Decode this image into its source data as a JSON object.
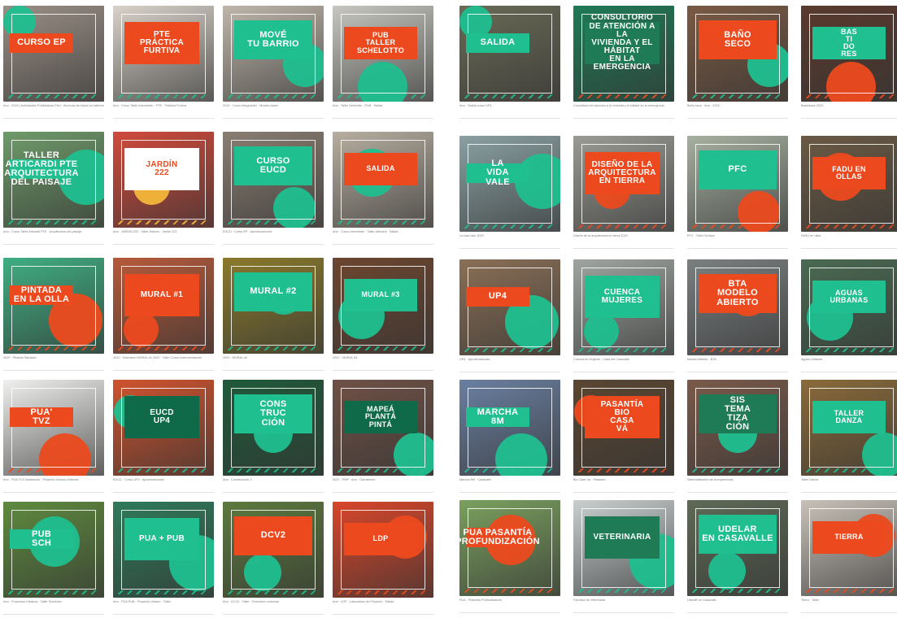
{
  "colors": {
    "orange": "#ec4a1e",
    "green": "#1fbf8f",
    "dark_green": "#0f6a4a",
    "white": "#ffffff"
  },
  "grid_left": [
    {
      "title": "CURSO EP",
      "caption": "Ano · 2018 | Actividades Publicitarias FAU · Alumnos de todos los talleres",
      "scene": "#9a8f86",
      "blob": "#1fbf8f",
      "box": "#ec4a1e",
      "ink": "#ffffff"
    },
    {
      "title": "PTE\nPRÁCTICA\nFURTIVA",
      "caption": "Ano · Curso Taller Intermedio · PTE · Práctica Furtiva",
      "scene": "#d8d2c9",
      "blob": "#1fbf8f",
      "box": "#ec4a1e",
      "ink": "#ffffff"
    },
    {
      "title": "MOVÉ\nTU BARRIO",
      "caption": "2019 · Curso Integración · Movetu barrio",
      "scene": "#bfb6aa",
      "blob": "#1fbf8f",
      "box": "#1fbf8f",
      "ink": "#ffffff"
    },
    {
      "title": "PUB\nTALLER\nSCHELOTTO",
      "caption": "Ano · Taller Schelotto · PUB · Salida",
      "scene": "#c7c7c0",
      "blob": "#1fbf8f",
      "box": "#ec4a1e",
      "ink": "#ffffff"
    },
    {
      "title": "TALLER\nARTICARDI PTE\nARQUITECTURA\nDEL PAISAJE",
      "caption": "Ano · Curso Taller Articardi PTE · Arquitectura del paisaje",
      "scene": "#6f9a6a",
      "blob": "#1fbf8f",
      "box": "#1fbf8f",
      "ink": "#ffffff"
    },
    {
      "title": "JARDÍN\n222",
      "caption": "Ano · JARDIN 222 · Taller Marcos · Jardín 222",
      "scene": "#d04a3c",
      "blob": "#f4b63a",
      "box": "#ffffff",
      "ink": "#ec4a1e"
    },
    {
      "title": "CURSO\nEUCD",
      "caption": "EUCD · Curso EP · Aproximaciones",
      "scene": "#8a7e72",
      "blob": "#1fbf8f",
      "box": "#1fbf8f",
      "ink": "#ffffff"
    },
    {
      "title": "SALIDA",
      "caption": "Ano · Curso Intermedio · Taller Articardi · Salida",
      "scene": "#b7aea0",
      "blob": "#1fbf8f",
      "box": "#ec4a1e",
      "ink": "#ffffff"
    },
    {
      "title": "PINTADA\nen la OLLA",
      "caption": "2020 · Pintada Salvador",
      "scene": "#3fae82",
      "blob": "#ec4a1e",
      "box": "#ec4a1e",
      "ink": "#ffffff"
    },
    {
      "title": "MURAL #1",
      "caption": "2020 · Extensión MURAL #1 2020 · Taller Curso Instrumentación",
      "scene": "#b65a3b",
      "blob": "#ec4a1e",
      "box": "#ec4a1e",
      "ink": "#ffffff"
    },
    {
      "title": "MURAL #2",
      "caption": "2020 · MURAL #2",
      "scene": "#8a7a2c",
      "blob": "#1fbf8f",
      "box": "#1fbf8f",
      "ink": "#ffffff"
    },
    {
      "title": "MURAL #3",
      "caption": "2020 · MURAL #3",
      "scene": "#6c4630",
      "blob": "#1fbf8f",
      "box": "#1fbf8f",
      "ink": "#ffffff"
    },
    {
      "title": "PUA'\nTVZ",
      "caption": "Ano · PUA TVZ Instalación · Proyecto Urbano Vivienda",
      "scene": "#f0f0ee",
      "blob": "#ec4a1e",
      "box": "#ec4a1e",
      "ink": "#ffffff"
    },
    {
      "title": "EUCD\nUP4",
      "caption": "EUCD · Curso UP4 · Aproximaciones",
      "scene": "#d0532e",
      "blob": "#1fbf8f",
      "box": "#0f6a4a",
      "ink": "#ffffff"
    },
    {
      "title": "CONS\nTRUC\nCIÓN",
      "caption": "Ano · Construcción 3",
      "scene": "#1f5a3a",
      "blob": "#1fbf8f",
      "box": "#1fbf8f",
      "ink": "#ffffff"
    },
    {
      "title": "MAPEÁ\nPLANTÁ\nPINTÁ",
      "caption": "2020 · PMP · Ano · Garrafones",
      "scene": "#6f5146",
      "blob": "#1fbf8f",
      "box": "#0f6a4a",
      "ink": "#ffffff"
    },
    {
      "title": "PUB\nSCH",
      "caption": "Ano · Proyectos Urbanos · Taller Schelotto",
      "scene": "#5e8a3e",
      "blob": "#1fbf8f",
      "box": "#1fbf8f",
      "ink": "#ffffff"
    },
    {
      "title": "PUA + PUB",
      "caption": "Ano · PUA PUB · Proyecto Urbano · Taller",
      "scene": "#2f7a5a",
      "blob": "#1fbf8f",
      "box": "#1fbf8f",
      "ink": "#ffffff"
    },
    {
      "title": "DCV2",
      "caption": "Ano · DCV2 · Taller · Extensión curricular",
      "scene": "#5c7a3e",
      "blob": "#1fbf8f",
      "box": "#ec4a1e",
      "ink": "#ffffff"
    },
    {
      "title": "LDP",
      "caption": "Ano · LDP · Laboratorio de Proyecto · Salida",
      "scene": "#d8462a",
      "blob": "#ec4a1e",
      "box": "#ec4a1e",
      "ink": "#ffffff"
    }
  ],
  "grid_right": [
    {
      "title": "SALIDA",
      "caption": "Ano · Salida curso UP4",
      "scene": "#6a6a56",
      "blob": "#1fbf8f",
      "box": "#1fbf8f",
      "ink": "#ffffff"
    },
    {
      "title": "Consultorio\nde atención a la\nvivienda y el hábitat\nen la emergencia",
      "caption": "Consultorio de atención a la vivienda y el hábitat en la emergencia",
      "scene": "#1f7a56",
      "blob": "#ec4a1e",
      "box": "#1f7a56",
      "ink": "#ffffff"
    },
    {
      "title": "BAÑO\nSECO",
      "caption": "Baño seco · Ano · 2020",
      "scene": "#7a5a44",
      "blob": "#1fbf8f",
      "box": "#ec4a1e",
      "ink": "#ffffff"
    },
    {
      "title": "BAS\nTI\nDO\nRES",
      "caption": "Bastidores 2020",
      "scene": "#5a3a2e",
      "blob": "#ec4a1e",
      "box": "#1fbf8f",
      "ink": "#ffffff"
    },
    {
      "title": "La\nvida\nvale",
      "caption": "La vida vale 2020",
      "scene": "#8aa0a2",
      "blob": "#1fbf8f",
      "box": "#1fbf8f",
      "ink": "#ffffff"
    },
    {
      "title": "DISEÑO DE LA\nARQUITECTURA\nEN TIERRA",
      "caption": "Diseño de la arquitectura en tierra 2020",
      "scene": "#9a9b94",
      "blob": "#ec4a1e",
      "box": "#ec4a1e",
      "ink": "#ffffff"
    },
    {
      "title": "PFC",
      "caption": "PFC · Taller Scheps",
      "scene": "#a6b0a0",
      "blob": "#ec4a1e",
      "box": "#1fbf8f",
      "ink": "#ffffff"
    },
    {
      "title": "FADU EN\nOLLAS",
      "caption": "FADU en ollas",
      "scene": "#6a5a44",
      "blob": "#ec4a1e",
      "box": "#ec4a1e",
      "ink": "#ffffff"
    },
    {
      "title": "UP4",
      "caption": "UP4 · Aproximaciones",
      "scene": "#8a6f56",
      "blob": "#1fbf8f",
      "box": "#ec4a1e",
      "ink": "#ffffff"
    },
    {
      "title": "CUENCA\nMUJERES",
      "caption": "Cuenca de Mujeres · Casa del Casavalle",
      "scene": "#9fa5a0",
      "blob": "#1fbf8f",
      "box": "#1fbf8f",
      "ink": "#ffffff"
    },
    {
      "title": "BTA\nModelo\nAbierto",
      "caption": "Modelo Abierto · BTA",
      "scene": "#7a7f80",
      "blob": "#ec4a1e",
      "box": "#ec4a1e",
      "ink": "#ffffff"
    },
    {
      "title": "AGUAS\nURBANAS",
      "caption": "Aguas Urbanas",
      "scene": "#4a6a52",
      "blob": "#1fbf8f",
      "box": "#1fbf8f",
      "ink": "#ffffff"
    },
    {
      "title": "Marcha\n8M",
      "caption": "Marcha 8M · Casavalle",
      "scene": "#6a7fa0",
      "blob": "#1fbf8f",
      "box": "#1fbf8f",
      "ink": "#ffffff"
    },
    {
      "title": "Pasantía\nBio\nCasa\nVá",
      "caption": "Bio Casa Vá · Pasantía",
      "scene": "#5a4632",
      "blob": "#ec4a1e",
      "box": "#ec4a1e",
      "ink": "#ffffff"
    },
    {
      "title": "Sis\ntema\ntiza\nción",
      "caption": "Sistematización de la experiencia",
      "scene": "#7a5a4a",
      "blob": "#1fbf8f",
      "box": "#1f7a56",
      "ink": "#ffffff"
    },
    {
      "title": "TALLER\nDANZA",
      "caption": "Taller Danza",
      "scene": "#8a6a3a",
      "blob": "#1fbf8f",
      "box": "#1fbf8f",
      "ink": "#ffffff"
    },
    {
      "title": "PUA PASANTÍA\nPROFUNDIZACIÓN",
      "caption": "PUA · Pasantía Profundización",
      "scene": "#7aa05e",
      "blob": "#ec4a1e",
      "box": "#ec4a1e",
      "ink": "#ffffff"
    },
    {
      "title": "Veterinaria",
      "caption": "Facultad de Veterinaria",
      "scene": "#c9cfcf",
      "blob": "#1fbf8f",
      "box": "#1f7a56",
      "ink": "#ffffff"
    },
    {
      "title": "UDELAR\nEN CASAVALLE",
      "caption": "UdelaR en Casavalle",
      "scene": "#5e6a56",
      "blob": "#1fbf8f",
      "box": "#1fbf8f",
      "ink": "#ffffff"
    },
    {
      "title": "TIERRA",
      "caption": "Tierra · Taller",
      "scene": "#c8c1b8",
      "blob": "#ec4a1e",
      "box": "#ec4a1e",
      "ink": "#ffffff"
    }
  ]
}
